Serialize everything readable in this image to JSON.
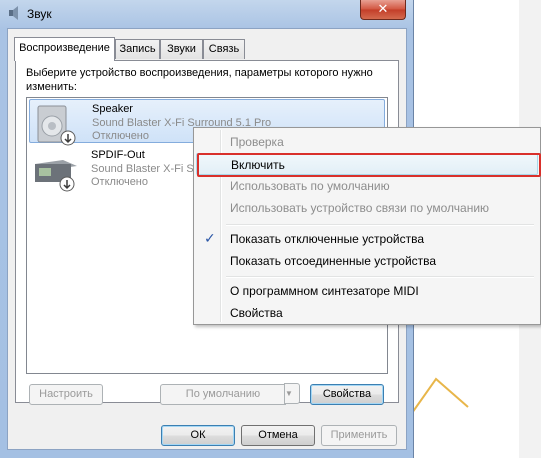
{
  "window": {
    "title": "Звук",
    "close_label": "✕"
  },
  "tabs": [
    {
      "label": "Воспроизведение",
      "active": true
    },
    {
      "label": "Запись",
      "active": false
    },
    {
      "label": "Звуки",
      "active": false
    },
    {
      "label": "Связь",
      "active": false
    }
  ],
  "panel": {
    "instruction": "Выберите устройство воспроизведения, параметры которого нужно изменить:"
  },
  "devices": [
    {
      "name": "Speaker",
      "description": "Sound Blaster X-Fi Surround 5.1 Pro",
      "status": "Отключено"
    },
    {
      "name": "SPDIF-Out",
      "description": "Sound Blaster X-Fi S",
      "status": "Отключено"
    }
  ],
  "panel_buttons": {
    "configure": "Настроить",
    "set_default": "По умолчанию",
    "properties": "Свойства"
  },
  "dialog_buttons": {
    "ok": "ОК",
    "cancel": "Отмена",
    "apply": "Применить"
  },
  "context_menu": {
    "items": [
      {
        "label": "Проверка",
        "enabled": false
      },
      {
        "label": "Включить",
        "enabled": true,
        "highlighted": true
      },
      {
        "label": "Использовать по умолчанию",
        "enabled": false
      },
      {
        "label": "Использовать устройство связи по умолчанию",
        "enabled": false
      },
      {
        "label": "Показать отключенные устройства",
        "enabled": true,
        "checked": true
      },
      {
        "label": "Показать отсоединенные устройства",
        "enabled": true
      },
      {
        "label": "О программном синтезаторе MIDI",
        "enabled": true
      },
      {
        "label": "Свойства",
        "enabled": true
      }
    ],
    "check_glyph": "✓"
  },
  "colors": {
    "highlight_outline": "#d9302b",
    "accent_check": "#2a56a6",
    "chevron": "#e8b64a"
  }
}
